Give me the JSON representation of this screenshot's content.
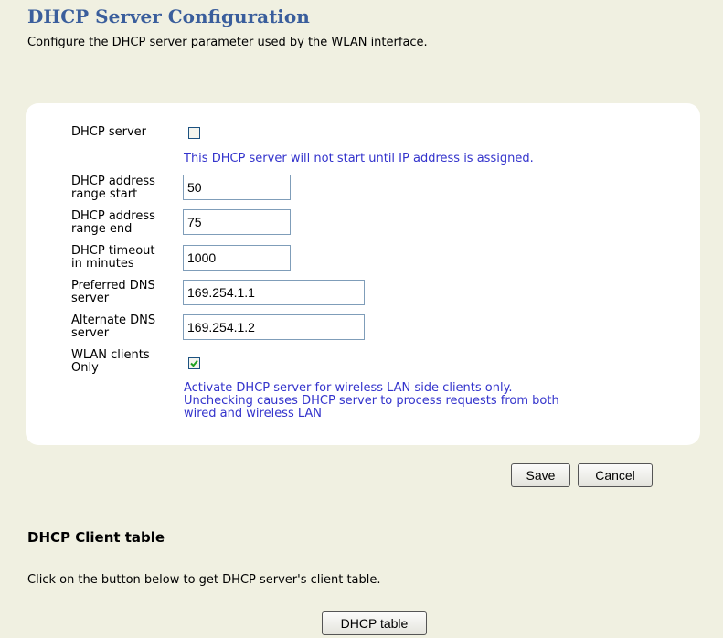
{
  "header": {
    "title": "DHCP Server Configuration",
    "description": "Configure the DHCP server parameter used by the WLAN interface."
  },
  "form": {
    "dhcp_server": {
      "label": "DHCP server",
      "checked": false,
      "note": "This DHCP server will not start until IP address is assigned."
    },
    "range_start": {
      "label_line1": "DHCP address",
      "label_line2": "range start",
      "value": "50"
    },
    "range_end": {
      "label_line1": "DHCP address",
      "label_line2": "range end",
      "value": "75"
    },
    "timeout": {
      "label_line1": "DHCP timeout",
      "label_line2": "in minutes",
      "value": "1000"
    },
    "preferred_dns": {
      "label_line1": "Preferred DNS",
      "label_line2": "server",
      "value": "169.254.1.1"
    },
    "alternate_dns": {
      "label_line1": "Alternate DNS",
      "label_line2": "server",
      "value": "169.254.1.2"
    },
    "wlan_only": {
      "label_line1": "WLAN clients",
      "label_line2": "Only",
      "checked": true,
      "note_line1": "Activate DHCP server for wireless LAN side clients only.",
      "note_line2": "Unchecking causes DHCP server to process requests from both",
      "note_line3": "wired and wireless LAN"
    }
  },
  "actions": {
    "save_label": "Save",
    "cancel_label": "Cancel"
  },
  "client_table": {
    "title": "DHCP Client table",
    "description": "Click on the button below to get DHCP server's client table.",
    "button_label": "DHCP table"
  },
  "colors": {
    "page_background": "#f0f0e1",
    "title": "#3a5e9c",
    "note": "#3333cc"
  }
}
